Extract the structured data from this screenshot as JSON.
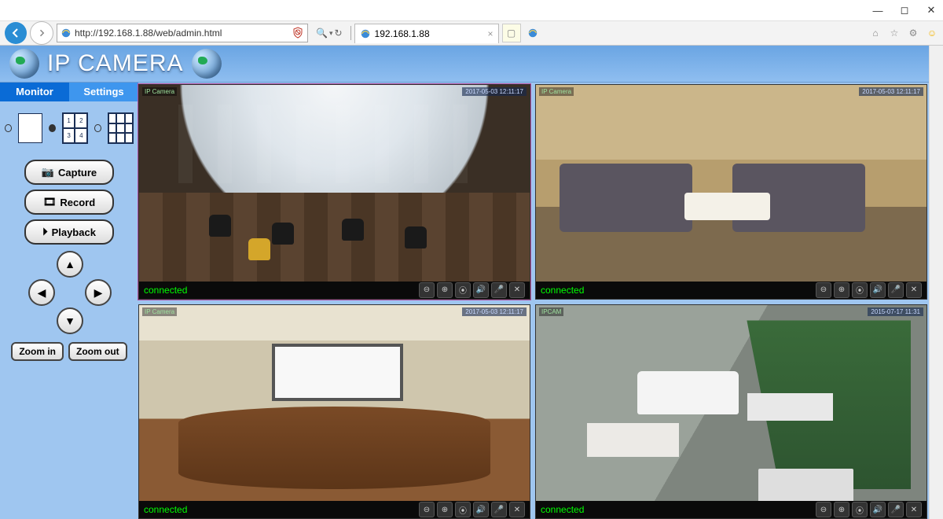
{
  "browser": {
    "url": "http://192.168.1.88/web/admin.html",
    "tab_title": "192.168.1.88"
  },
  "header": {
    "brand": "IP CAMERA"
  },
  "sidebar": {
    "tabs": {
      "monitor": "Monitor",
      "settings": "Settings"
    },
    "layout_quad_cells": [
      "1",
      "2",
      "3",
      "4"
    ],
    "buttons": {
      "capture": "Capture",
      "record": "Record",
      "playback": "Playback"
    },
    "zoom": {
      "in": "Zoom in",
      "out": "Zoom out"
    }
  },
  "feeds": [
    {
      "status": "connected",
      "label_tl": "IP Camera",
      "timestamp": "2017-05-03 12:11:17"
    },
    {
      "status": "connected",
      "label_tl": "IP Camera",
      "timestamp": "2017-05-03 12:11:17"
    },
    {
      "status": "connected",
      "label_tl": "IP Camera",
      "timestamp": "2017-05-03 12:11:17"
    },
    {
      "status": "connected",
      "label_tl": "IPCAM",
      "timestamp": "2015-07-17 11:31"
    }
  ]
}
